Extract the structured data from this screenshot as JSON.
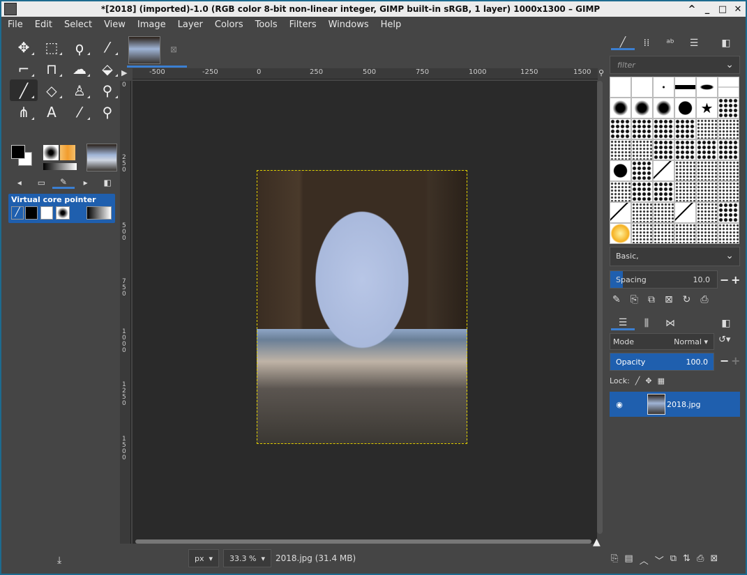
{
  "window": {
    "title": "*[2018] (imported)-1.0 (RGB color 8-bit non-linear integer, GIMP built-in sRGB, 1 layer) 1000x1300 – GIMP",
    "controls": [
      "^",
      "_",
      "□",
      "✕"
    ]
  },
  "menu": [
    "File",
    "Edit",
    "Select",
    "View",
    "Image",
    "Layer",
    "Colors",
    "Tools",
    "Filters",
    "Windows",
    "Help"
  ],
  "toolbox": {
    "tools": [
      "move-icon",
      "rect-select-icon",
      "lasso-icon",
      "fuzzy-select-icon",
      "crop-icon",
      "transform-icon",
      "warp-icon",
      "bucket-fill-icon",
      "paintbrush-icon",
      "eraser-icon",
      "clone-icon",
      "smudge-icon",
      "paths-icon",
      "text-icon",
      "color-picker-icon",
      "zoom-icon"
    ],
    "tool_glyphs": [
      "✥",
      "⬚",
      "⚲",
      "⁄",
      "⌗",
      "⊞",
      "☁",
      "⬙",
      "🖌",
      "✎",
      "♙",
      "⚶",
      "⋔",
      "A",
      "⁄",
      "🔍"
    ],
    "options_title": "Virtual core pointer"
  },
  "ruler_top": [
    "-500",
    "-250",
    "0",
    "250",
    "500",
    "750",
    "1000",
    "1250",
    "1500"
  ],
  "ruler_left": [
    "0",
    "250",
    "500",
    "750",
    "1000",
    "1250",
    "1500"
  ],
  "status": {
    "unit": "px",
    "zoom": "33.3 %",
    "file": "2018.jpg (31.4 MB)"
  },
  "brushes": {
    "filter_placeholder": "filter",
    "preset": "Basic,",
    "spacing_label": "Spacing",
    "spacing_value": "10.0"
  },
  "layers": {
    "mode_label": "Mode",
    "mode_value": "Normal",
    "opacity_label": "Opacity",
    "opacity_value": "100.0",
    "lock_label": "Lock:",
    "layer_name": "2018.jpg"
  },
  "colors": {
    "accent": "#1f5fae",
    "bg": "#454545",
    "canvas": "#2a2a2a"
  }
}
